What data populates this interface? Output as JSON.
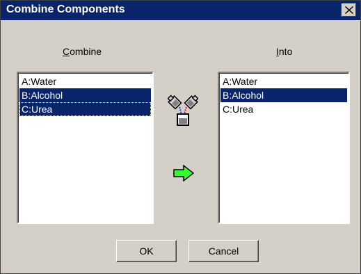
{
  "window": {
    "title": "Combine Components",
    "close_icon": "close-icon"
  },
  "combine": {
    "label_accel": "C",
    "label_rest": "ombine",
    "items": [
      {
        "label": "A:Water",
        "selected": false
      },
      {
        "label": "B:Alcohol",
        "selected": true
      },
      {
        "label": "C:Urea",
        "selected": true,
        "focused": true
      }
    ]
  },
  "into": {
    "label_accel": "I",
    "label_rest": "nto",
    "items": [
      {
        "label": "A:Water",
        "selected": false
      },
      {
        "label": "B:Alcohol",
        "selected": true
      },
      {
        "label": "C:Urea",
        "selected": false
      }
    ]
  },
  "icons": {
    "mixer": "mixer-icon",
    "arrow": "right-arrow-icon"
  },
  "colors": {
    "selection": "#0a246a",
    "arrow_fill": "#33ff33"
  },
  "buttons": {
    "ok": "OK",
    "cancel": "Cancel"
  }
}
